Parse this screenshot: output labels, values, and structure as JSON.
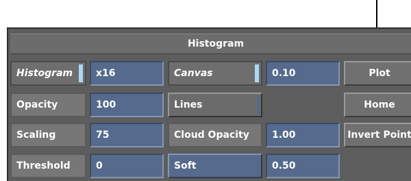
{
  "panel": {
    "title": "Histogram",
    "histogram_toggle": "Histogram",
    "histogram_value": "x16",
    "canvas_toggle": "Canvas",
    "canvas_value": "0.10",
    "plot_button": "Plot",
    "opacity_label": "Opacity",
    "opacity_value": "100",
    "lines_button": "Lines",
    "home_button": "Home",
    "scaling_label": "Scaling",
    "scaling_value": "75",
    "cloud_opacity_label": "Cloud Opacity",
    "cloud_opacity_value": "1.00",
    "invert_point_button": "Invert Point",
    "threshold_label": "Threshold",
    "threshold_value": "0",
    "soft_button": "Soft",
    "soft_value": "0.50"
  },
  "colors": {
    "panel_bg": "#5d5d5d",
    "field_blue": "#556a8c",
    "toggle_indicator": "#a9d7f5",
    "label_gray": "#777777"
  }
}
